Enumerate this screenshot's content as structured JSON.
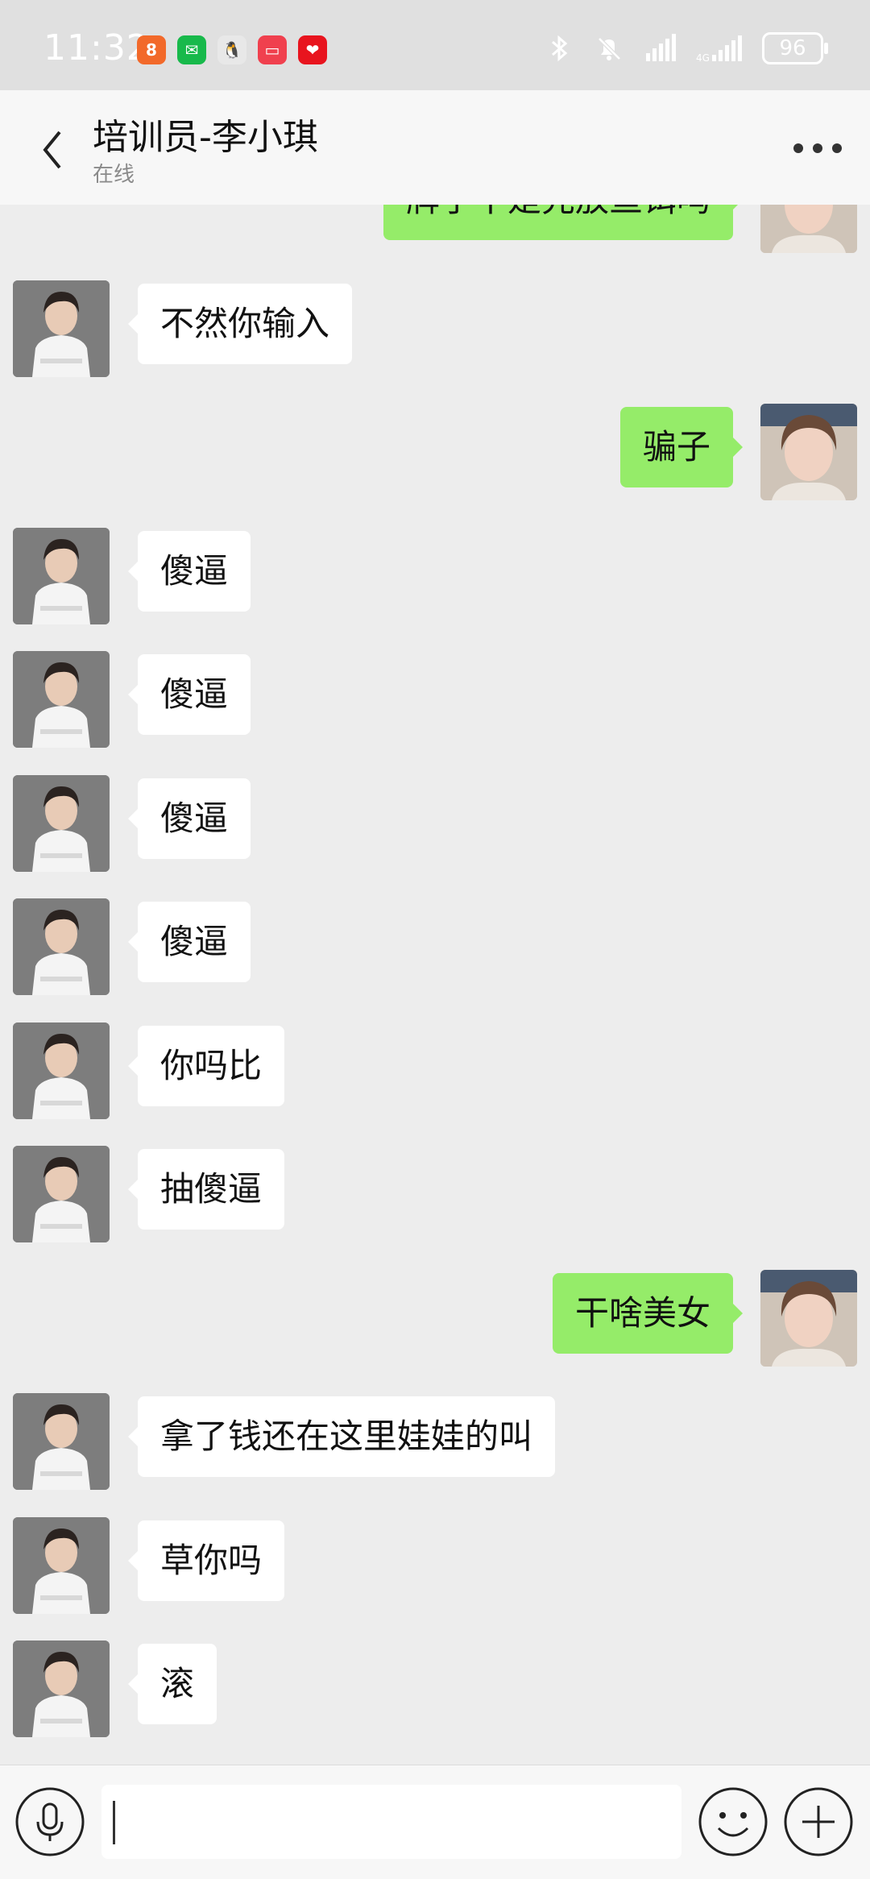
{
  "status_bar": {
    "time": "11:32",
    "battery": "96",
    "app_icons": [
      {
        "name": "xiaohongshu-icon",
        "color": "#f2692a",
        "glyph": "8"
      },
      {
        "name": "wechat-icon",
        "color": "#18b94b",
        "glyph": "✉"
      },
      {
        "name": "qq-icon",
        "color": "#e8e8e8",
        "glyph": "🐧"
      },
      {
        "name": "red-app-icon",
        "color": "#f0404e",
        "glyph": "▭"
      },
      {
        "name": "pinduoduo-icon",
        "color": "#e8141e",
        "glyph": "❤"
      }
    ]
  },
  "header": {
    "title": "培训员-李小琪",
    "subtitle": "在线"
  },
  "messages": [
    {
      "side": "right",
      "text": "牌子不是先放鱼饵吗"
    },
    {
      "side": "left",
      "text": "不然你输入"
    },
    {
      "side": "right",
      "text": "骗子"
    },
    {
      "side": "left",
      "text": "傻逼"
    },
    {
      "side": "left",
      "text": "傻逼"
    },
    {
      "side": "left",
      "text": "傻逼"
    },
    {
      "side": "left",
      "text": "傻逼"
    },
    {
      "side": "left",
      "text": "你吗比"
    },
    {
      "side": "left",
      "text": "抽傻逼"
    },
    {
      "side": "right",
      "text": "干啥美女"
    },
    {
      "side": "left",
      "text": "拿了钱还在这里娃娃的叫"
    },
    {
      "side": "left",
      "text": "草你吗"
    },
    {
      "side": "left",
      "text": "滚"
    }
  ],
  "input": {
    "value": "",
    "placeholder": ""
  },
  "colors": {
    "bubble_sent": "#95ec69",
    "bubble_received": "#ffffff",
    "background": "#ededed"
  }
}
